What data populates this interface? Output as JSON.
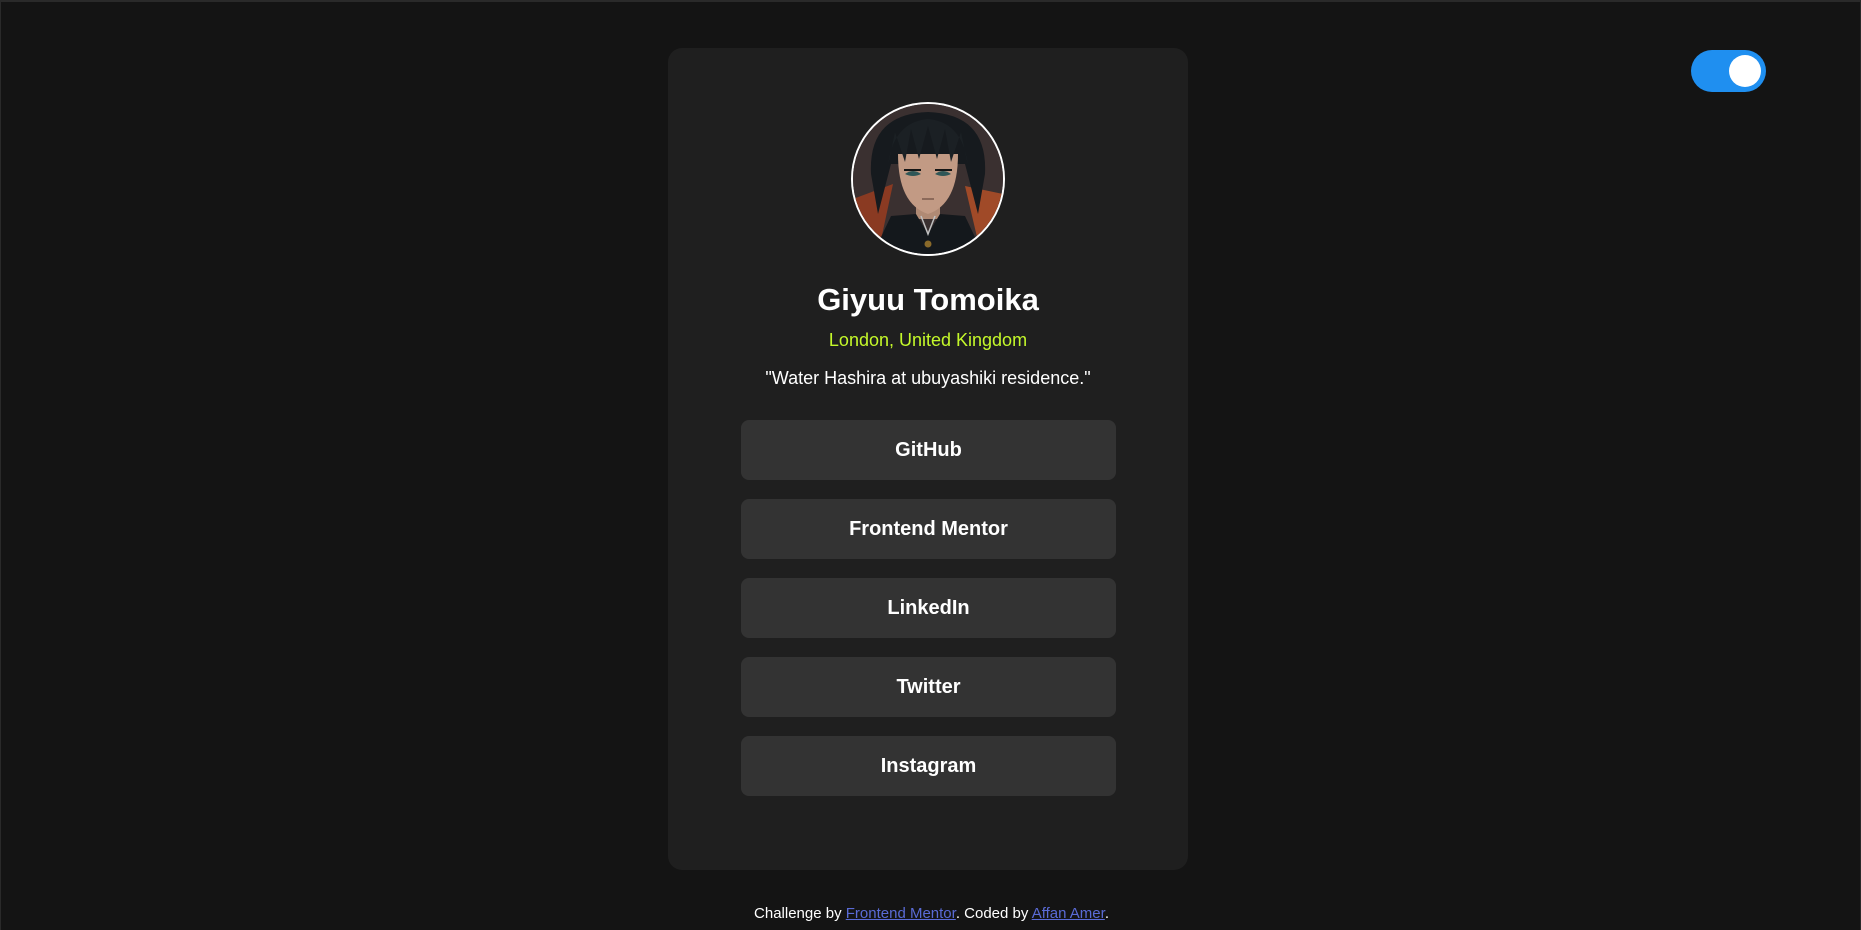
{
  "theme_toggle": {
    "state": "on",
    "color": "#1f8ff0"
  },
  "profile": {
    "avatar_icon": "anime-character-avatar",
    "name": "Giyuu Tomoika",
    "location": "London, United Kingdom",
    "bio": "\"Water Hashira at ubuyashiki residence.\""
  },
  "links": [
    {
      "label": "GitHub"
    },
    {
      "label": "Frontend Mentor"
    },
    {
      "label": "LinkedIn"
    },
    {
      "label": "Twitter"
    },
    {
      "label": "Instagram"
    }
  ],
  "footer": {
    "prefix": "Challenge by ",
    "challenge_link": "Frontend Mentor",
    "middle": ". Coded by ",
    "author_link": "Affan Amer",
    "suffix": "."
  },
  "colors": {
    "background": "#141414",
    "card": "#1f1f1f",
    "button": "#333333",
    "accent_location": "#c4f82a",
    "footer_link": "#5a6bd6"
  }
}
